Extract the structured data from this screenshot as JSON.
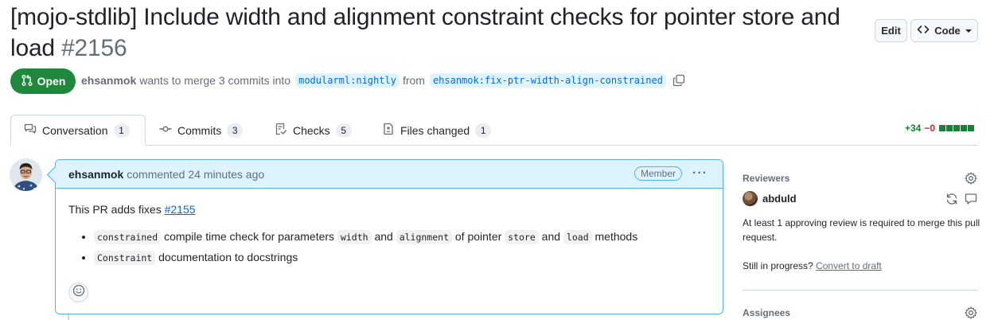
{
  "pr": {
    "title": "[mojo-stdlib] Include width and alignment constraint checks for pointer store and load",
    "number": "#2156",
    "state": "Open",
    "author": "ehsanmok",
    "merge_text": "wants to merge 3 commits into",
    "base_branch": "modularml:nightly",
    "from_text": "from",
    "head_branch": "ehsanmok:fix-ptr-width-align-constrained"
  },
  "header_buttons": {
    "edit": "Edit",
    "code": "Code"
  },
  "tabs": [
    {
      "label": "Conversation",
      "count": "1",
      "icon": "comment-discussion-icon"
    },
    {
      "label": "Commits",
      "count": "3",
      "icon": "git-commit-icon"
    },
    {
      "label": "Checks",
      "count": "5",
      "icon": "checklist-icon"
    },
    {
      "label": "Files changed",
      "count": "1",
      "icon": "file-diff-icon"
    }
  ],
  "diffstat": {
    "additions": "+34",
    "deletions": "−0"
  },
  "comment": {
    "author": "ehsanmok",
    "action": "commented",
    "time": "24 minutes ago",
    "role": "Member",
    "intro": "This PR adds fixes",
    "issue_link": "#2155",
    "bullet1": {
      "code1": "constrained",
      "t1": "compile time check for parameters",
      "code2": "width",
      "t2": "and",
      "code3": "alignment",
      "t3": "of pointer",
      "code4": "store",
      "t4": "and",
      "code5": "load",
      "t5": "methods"
    },
    "bullet2": {
      "code1": "Constraint",
      "t1": "documentation to docstrings"
    }
  },
  "sidebar": {
    "reviewers_heading": "Reviewers",
    "reviewer": "abduld",
    "review_note": "At least 1 approving review is required to merge this pull request.",
    "draft_prefix": "Still in progress?",
    "draft_link": "Convert to draft",
    "assignees_heading": "Assignees"
  },
  "colors": {
    "open_green": "#1f883d",
    "link_blue": "#0969da",
    "comment_header_bg": "#ddf4ff",
    "comment_border": "#54aeff"
  }
}
